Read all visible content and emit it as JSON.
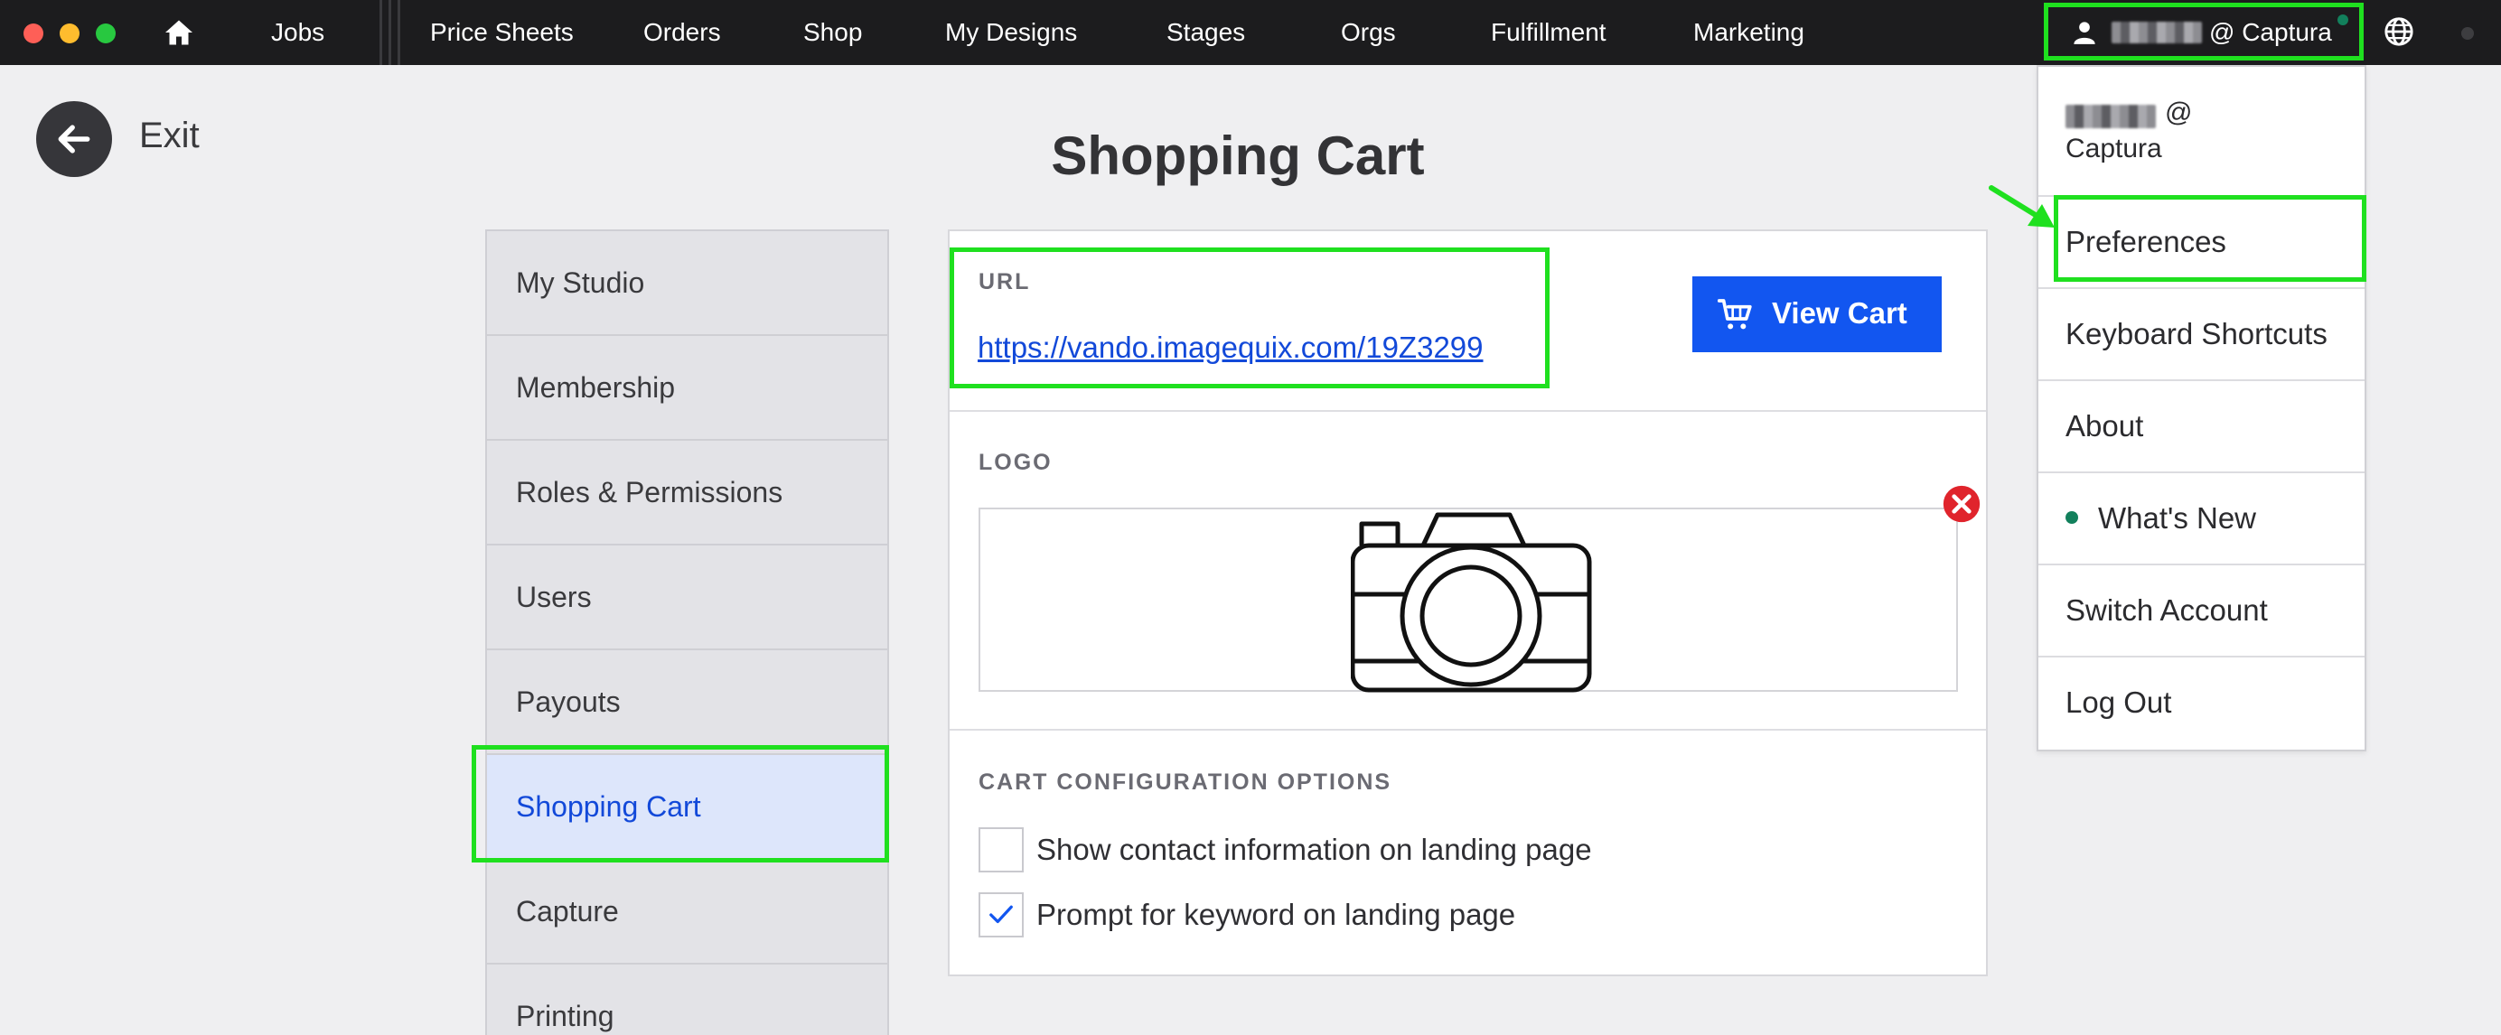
{
  "nav": {
    "items": [
      "Jobs",
      "Price Sheets",
      "Orders",
      "Shop",
      "My Designs",
      "Stages",
      "Orgs",
      "Fulfillment",
      "Marketing"
    ],
    "user_label": "@ Captura"
  },
  "exit": {
    "label": "Exit"
  },
  "page": {
    "title": "Shopping Cart"
  },
  "sidebar": {
    "items": [
      {
        "label": "My Studio"
      },
      {
        "label": "Membership"
      },
      {
        "label": "Roles & Permissions"
      },
      {
        "label": "Users"
      },
      {
        "label": "Payouts"
      },
      {
        "label": "Shopping Cart",
        "active": true
      },
      {
        "label": "Capture"
      },
      {
        "label": "Printing"
      }
    ]
  },
  "main": {
    "url_label": "URL",
    "url_value": "https://vando.imagequix.com/19Z3299",
    "view_cart_label": "View Cart",
    "logo_label": "LOGO",
    "config_label": "CART CONFIGURATION OPTIONS",
    "options": [
      {
        "label": "Show contact information on landing page",
        "checked": false
      },
      {
        "label": "Prompt for keyword on landing page",
        "checked": true
      }
    ]
  },
  "user_menu": {
    "header_at": "@",
    "header_org": "Captura",
    "items": [
      "Preferences",
      "Keyboard Shortcuts",
      "About",
      "What's New",
      "Switch Account",
      "Log Out"
    ]
  },
  "colors": {
    "accent": "#1256f0",
    "highlight": "#1fe01f",
    "link": "#1249d9",
    "status_dot": "#12805c",
    "remove": "#e0242c"
  }
}
